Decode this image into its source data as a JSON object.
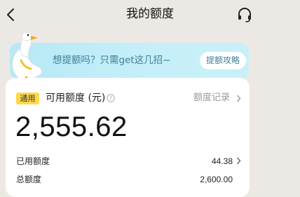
{
  "header": {
    "title": "我的额度"
  },
  "banner": {
    "text": "想提额吗？只需get这几招~",
    "button_label": "提额攻略"
  },
  "card": {
    "badge": "通用",
    "available_label": "可用额度 (元)",
    "records_link": "额度记录",
    "amount": "2,555.62",
    "rows": [
      {
        "label": "已用额度",
        "value": "44.38"
      },
      {
        "label": "总额度",
        "value": "2,600.00"
      }
    ]
  },
  "colors": {
    "banner_background": "#c3eef8",
    "badge_background": "#ffd84a",
    "page_background": "#ece9e5"
  },
  "icons": [
    "back-arrow-icon",
    "headset-icon",
    "info-icon",
    "chevron-right-icon",
    "goose-mascot-icon"
  ]
}
